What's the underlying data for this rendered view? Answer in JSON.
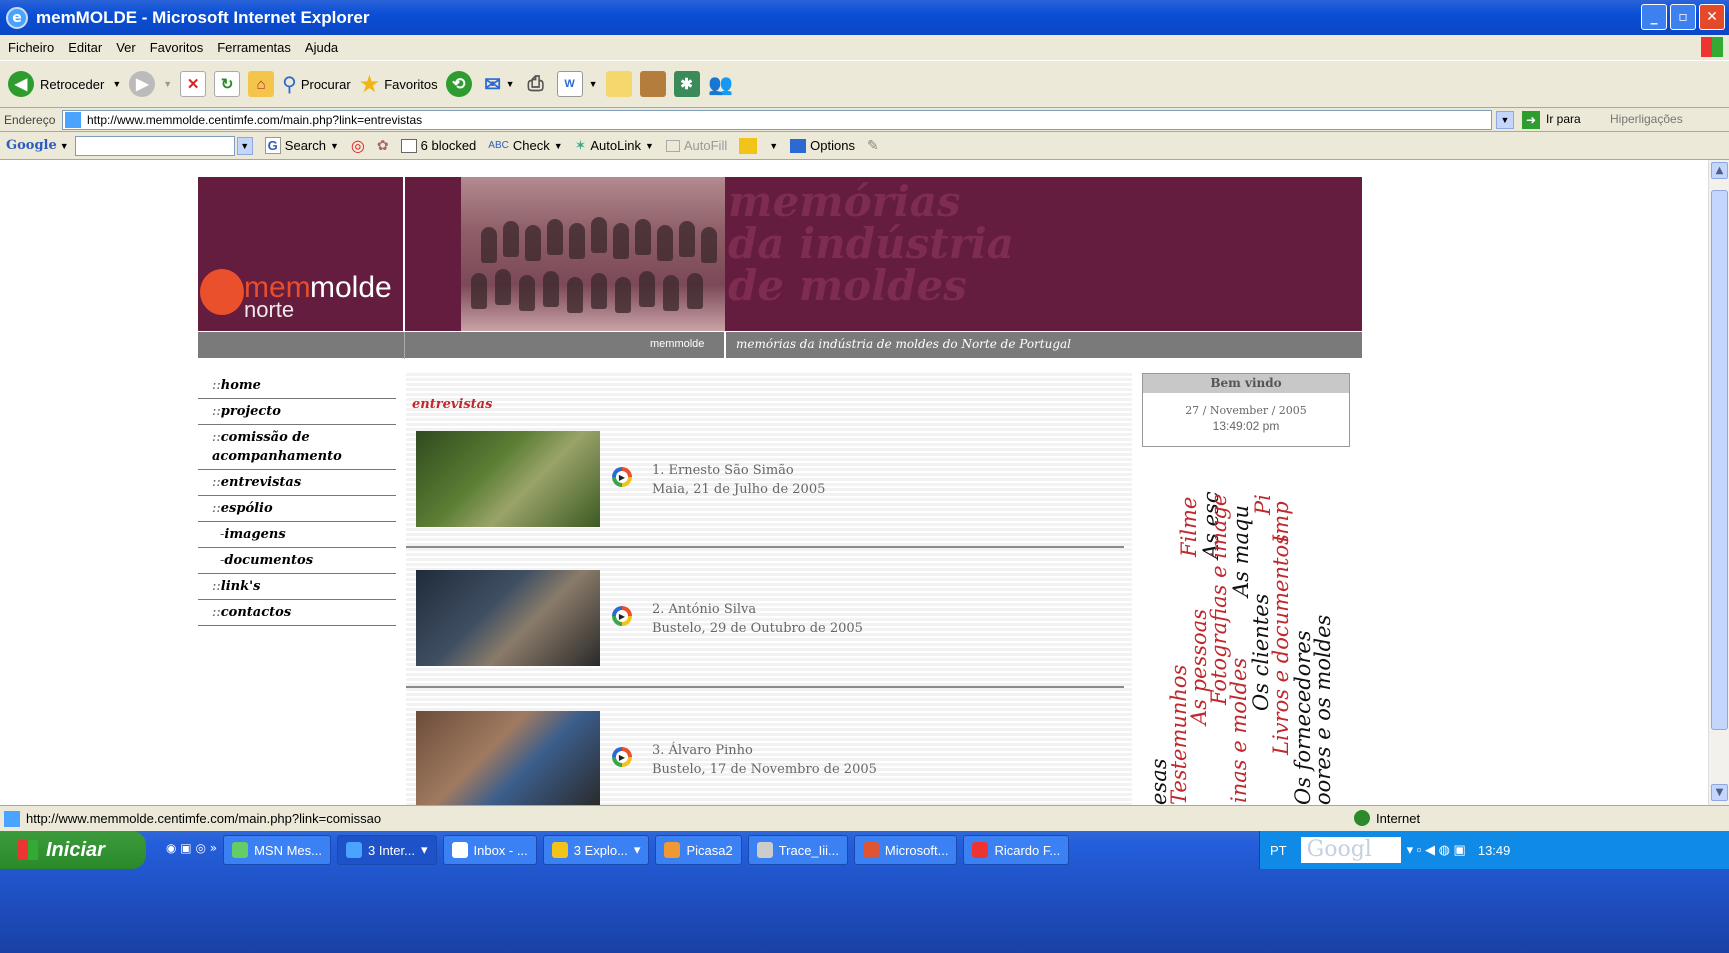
{
  "window": {
    "title": "memMOLDE - Microsoft Internet Explorer"
  },
  "menu": [
    "Ficheiro",
    "Editar",
    "Ver",
    "Favoritos",
    "Ferramentas",
    "Ajuda"
  ],
  "toolbar": {
    "back": "Retroceder",
    "search": "Procurar",
    "favorites": "Favoritos"
  },
  "address": {
    "label": "Endereço",
    "url": "http://www.memmolde.centimfe.com/main.php?link=entrevistas",
    "go": "Ir para",
    "links": "Hiperligações"
  },
  "google_bar": {
    "brand": "Google",
    "search": "Search",
    "blocked": "6 blocked",
    "check": "Check",
    "autolink": "AutoLink",
    "autofill": "AutoFill",
    "options": "Options"
  },
  "site": {
    "logo": {
      "mem": "mem",
      "molde": "molde",
      "norte": "norte"
    },
    "header_lines": [
      "memórias",
      "da indústria",
      "de moldes"
    ],
    "subbar_left": "memmolde",
    "subbar_right": "memórias da indústria de moldes do Norte de Portugal",
    "nav": [
      {
        "prefix": "::",
        "label": "home"
      },
      {
        "prefix": "::",
        "label": "projecto"
      },
      {
        "prefix": "::",
        "label": "comissão de acompanhamento"
      },
      {
        "prefix": "::",
        "label": "entrevistas"
      },
      {
        "prefix": "::",
        "label": "espólio"
      },
      {
        "prefix": "-",
        "label": "imagens"
      },
      {
        "prefix": "-",
        "label": "documentos"
      },
      {
        "prefix": "::",
        "label": "link's"
      },
      {
        "prefix": "::",
        "label": "contactos"
      }
    ],
    "section_title": "entrevistas",
    "entries": [
      {
        "name": "1. Ernesto São Simão",
        "place_date": "Maia, 21 de Julho de 2005"
      },
      {
        "name": "2. António Silva",
        "place_date": "Bustelo, 29 de Outubro de 2005"
      },
      {
        "name": "3. Álvaro Pinho",
        "place_date": "Bustelo, 17 de Novembro de 2005"
      }
    ],
    "welcome": {
      "title": "Bem vindo",
      "date": "27 / November / 2005",
      "time": "13:49:02 pm"
    },
    "rotated_words": [
      {
        "text": "Filme",
        "color": "#c0282d"
      },
      {
        "text": "As esc",
        "color": "#111111"
      },
      {
        "text": "esas",
        "color": "#111111"
      },
      {
        "text": "Testemunhos",
        "color": "#c0282d"
      },
      {
        "text": "As pessoas",
        "color": "#c0282d"
      },
      {
        "text": "Fotografias e image",
        "color": "#c0282d"
      },
      {
        "text": "inas e moldes",
        "color": "#c0282d"
      },
      {
        "text": "As maqu",
        "color": "#111111"
      },
      {
        "text": "Os clientes",
        "color": "#111111"
      },
      {
        "text": "Livros e documentos",
        "color": "#c0282d"
      },
      {
        "text": "Imp",
        "color": "#c0282d"
      },
      {
        "text": "Pi",
        "color": "#c0282d"
      },
      {
        "text": "Os fornecedores",
        "color": "#111111"
      },
      {
        "text": "oores e os moldes",
        "color": "#111111"
      }
    ]
  },
  "status": {
    "url": "http://www.memmolde.centimfe.com/main.php?link=comissao",
    "zone": "Internet"
  },
  "taskbar": {
    "start": "Iniciar",
    "tasks": [
      "MSN Mes...",
      "3 Inter...",
      "Inbox - ...",
      "3 Explo...",
      "Picasa2",
      "Trace_Iii...",
      "Microsoft...",
      "Ricardo F..."
    ],
    "lang": "PT",
    "search_brand": "Googl",
    "clock": "13:49"
  },
  "colors": {
    "brand_wine": "#641c3f",
    "accent_red": "#c0282d",
    "logo_orange": "#e9502b"
  }
}
